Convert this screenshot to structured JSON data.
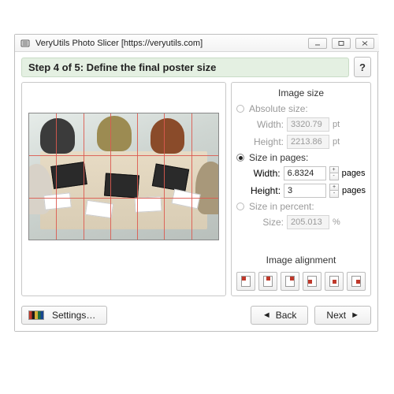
{
  "window": {
    "title": "VeryUtils Photo Slicer [https://veryutils.com]"
  },
  "step": {
    "heading": "Step 4 of 5: Define the final poster size",
    "help": "?"
  },
  "sizePanel": {
    "title": "Image size",
    "absolute": {
      "label": "Absolute size:",
      "widthLabel": "Width:",
      "widthValue": "3320.79",
      "widthUnit": "pt",
      "heightLabel": "Height:",
      "heightValue": "2213.86",
      "heightUnit": "pt"
    },
    "pages": {
      "label": "Size in pages:",
      "widthLabel": "Width:",
      "widthValue": "6.8324",
      "widthUnit": "pages",
      "heightLabel": "Height:",
      "heightValue": "3",
      "heightUnit": "pages"
    },
    "percent": {
      "label": "Size in percent:",
      "sizeLabel": "Size:",
      "sizeValue": "205.013",
      "sizeUnit": "%"
    }
  },
  "alignment": {
    "title": "Image alignment"
  },
  "preview": {
    "cols": 7,
    "rows": 3
  },
  "buttons": {
    "settings": "Settings…",
    "back": "Back",
    "next": "Next"
  },
  "stepper": {
    "plus": "+",
    "minus": "-"
  }
}
